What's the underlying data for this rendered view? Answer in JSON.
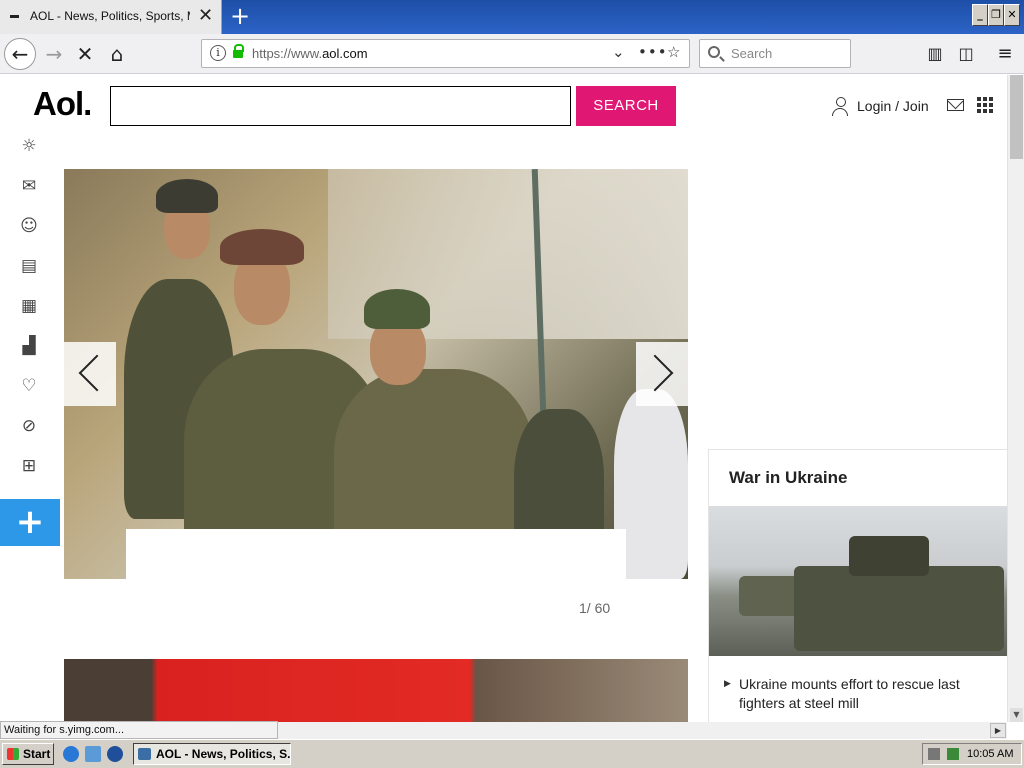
{
  "browser": {
    "tab_title": "AOL - News, Politics, Sports, Mail",
    "url_prefix": "https://www.",
    "url_domain": "aol.com",
    "search_placeholder": "Search",
    "status_text": "Waiting for s.yimg.com..."
  },
  "page": {
    "logo": "Aol.",
    "search_button": "SEARCH",
    "login_label": "Login / Join",
    "side_icons": [
      "weather-icon",
      "mail-icon",
      "user-icon",
      "news-icon",
      "video-icon",
      "finance-icon",
      "heart-icon",
      "sports-icon",
      "games-icon"
    ],
    "slideshow": {
      "counter": "1/ 60"
    },
    "ukraine": {
      "heading": "War in Ukraine",
      "story": "Ukraine mounts effort to rescue last fighters at steel mill"
    },
    "accent_color": "#e01773",
    "plus_color": "#2d98e8"
  },
  "taskbar": {
    "start_label": "Start",
    "task_label": "AOL - News, Politics, S...",
    "clock": "10:05 AM"
  }
}
